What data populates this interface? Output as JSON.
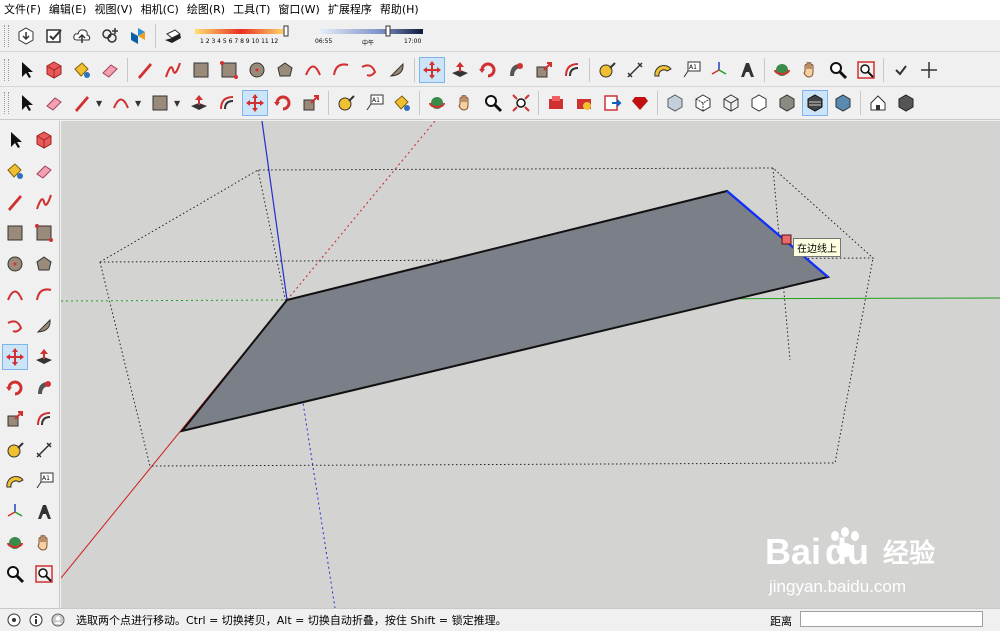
{
  "menus": [
    "文件(F)",
    "编辑(E)",
    "视图(V)",
    "相机(C)",
    "绘图(R)",
    "工具(T)",
    "窗口(W)",
    "扩展程序",
    "帮助(H)"
  ],
  "shadow": {
    "months": "1 2 3 4 5 6 7 8 9 10 11 12",
    "time_start": "06:55",
    "time_mid": "中午",
    "time_end": "17:00"
  },
  "viewport": {
    "tooltip": "在边线上",
    "face_color": "#7b7f87",
    "background": "#d3d3d1"
  },
  "watermark": {
    "brand_left": "Bai",
    "brand_right": "du",
    "brand_cn": "经验",
    "url": "jingyan.baidu.com"
  },
  "status": {
    "hint": "选取两个点进行移动。Ctrl = 切换拷贝，Alt = 切换自动折叠，按住 Shift = 锁定推理。",
    "distance_label": "距离",
    "distance_value": ""
  }
}
